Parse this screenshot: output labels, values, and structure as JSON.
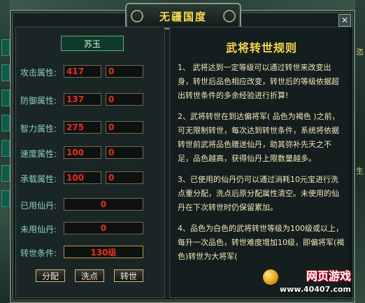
{
  "window": {
    "title": "无疆国度",
    "close_glyph": "✕"
  },
  "character": {
    "name": "苏玉"
  },
  "attributes": [
    {
      "label": "攻击属性:",
      "base": "417",
      "bonus": "0"
    },
    {
      "label": "防御属性:",
      "base": "137",
      "bonus": "0"
    },
    {
      "label": "智力属性:",
      "base": "275",
      "bonus": "0"
    },
    {
      "label": "速度属性:",
      "base": "100",
      "bonus": "0"
    },
    {
      "label": "承载属性:",
      "base": "100",
      "bonus": "0"
    }
  ],
  "pills": {
    "used_label": "已用仙丹:",
    "used_value": "0",
    "unused_label": "未用仙丹:",
    "unused_value": "0"
  },
  "rebirth": {
    "label": "转世条件:",
    "value": "130级"
  },
  "buttons": {
    "allocate": "分配",
    "wash": "洗点",
    "rebirth": "转世"
  },
  "rules": {
    "title": "武将转世规则",
    "items": [
      "1、 武将达到一定等级可以通过转世来改变出身，转世后品色相应改变，转世后的等级依据超出转世条件的多余经验进行折算!",
      "2、武将转世在到达偏将军( 品色为褐色 )之前，可无限制转世，每次达到转世条件，系统将依据转世前武将品色赠送仙丹，助其弥补先天之不足，品色越高，获得仙丹上限数量越多。",
      "3、已使用的仙丹仍可以通过消耗10元宝进行洗点重分配，洗点后原分配属性清空。未使用的仙丹在下次转世时仍保留累加。",
      "4、品色为白色的武将转世等级为100级或以上，每升一次品色，转世难度增加10级，即偏将军(褐色)转世为大将军("
    ]
  },
  "background": {
    "right_glyph_1": "恣",
    "right_glyph_2": "生"
  },
  "watermark": {
    "title": "网页游戏",
    "url": "www.40407.com"
  }
}
